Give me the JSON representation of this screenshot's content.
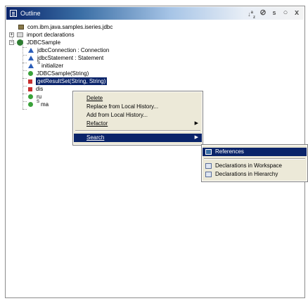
{
  "window": {
    "title": "Outline"
  },
  "toolbar": {
    "sort_icon": "sort-alpha-icon",
    "hide_fields_icon": "hide-fields-icon",
    "hide_static_icon": "hide-static-icon",
    "hide_nonpublic_icon": "hide-nonpublic-icon",
    "close_label": "x"
  },
  "tree": {
    "package": "com.ibm.java.samples.iseries.jdbc",
    "imports": "import declarations",
    "class": "JDBCSample",
    "members": [
      {
        "label": "jdbcConnection : Connection",
        "icon": "field-icon"
      },
      {
        "label": "jdbcStatement : Statement",
        "icon": "field-icon"
      },
      {
        "label": "initializer",
        "icon": "static-field-icon",
        "sup": "S"
      },
      {
        "label": "JDBCSample(String)",
        "icon": "public-method-icon"
      },
      {
        "label": "getResultSet(String, String)",
        "icon": "private-method-icon"
      },
      {
        "label": "dis",
        "icon": "private-method-icon"
      },
      {
        "label": "ru",
        "icon": "public-method-icon"
      },
      {
        "label": "ma",
        "icon": "static-method-icon",
        "sup": "S"
      }
    ]
  },
  "context_menu": {
    "items": [
      {
        "label": "Delete"
      },
      {
        "label": "Replace from Local History..."
      },
      {
        "label": "Add from Local History..."
      },
      {
        "label": "Refactor",
        "submenu": true
      },
      {
        "label": "Search",
        "submenu": true,
        "highlighted": true
      }
    ]
  },
  "submenu": {
    "items": [
      {
        "label": "References",
        "highlighted": true
      },
      {
        "label": "Declarations in Workspace"
      },
      {
        "label": "Declarations in Hierarchy"
      }
    ]
  }
}
